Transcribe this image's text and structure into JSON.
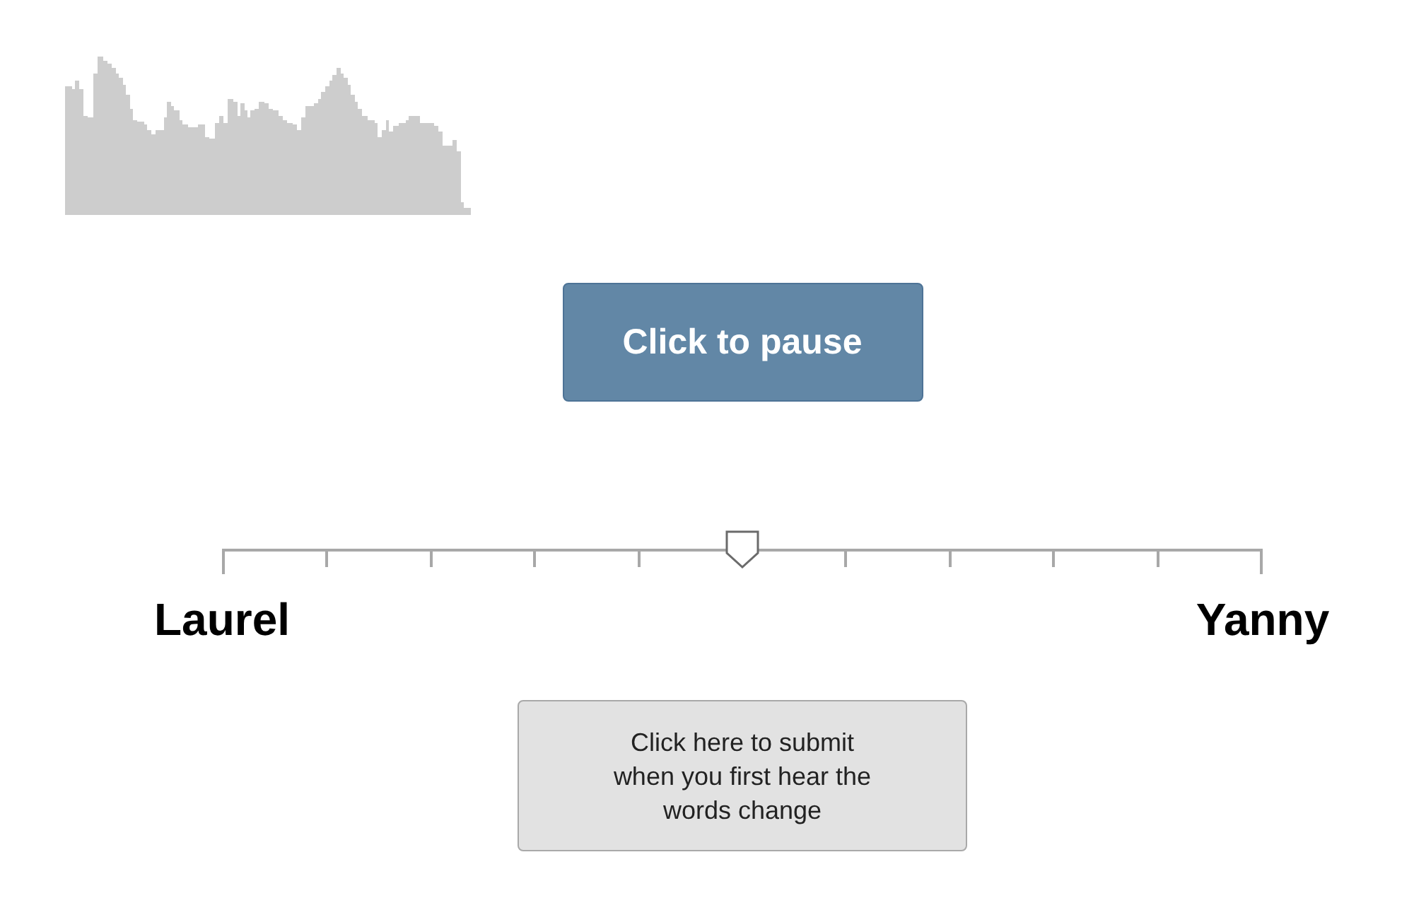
{
  "pause_button": {
    "label": "Click to pause"
  },
  "slider": {
    "level": 0.5,
    "left_label": "Laurel",
    "right_label": "Yanny"
  },
  "submit_button": {
    "label": "Click here to submit when you first hear the words change"
  }
}
